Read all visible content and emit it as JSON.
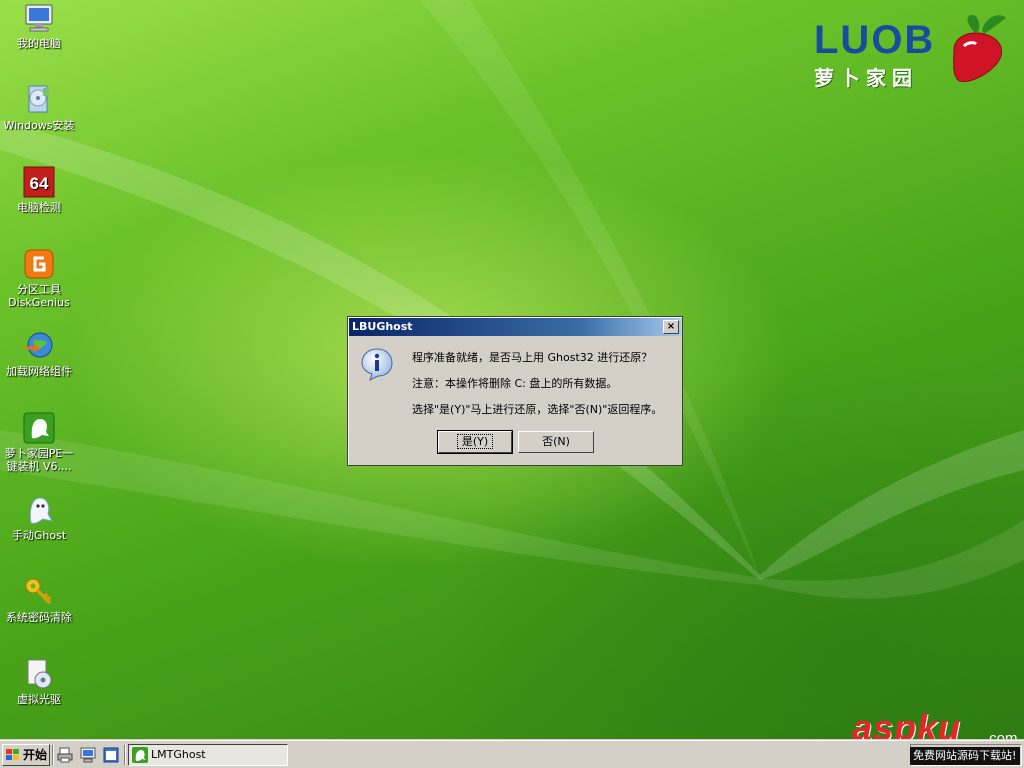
{
  "desktop": {
    "icons": [
      {
        "label": "我的电脑",
        "icon": "computer-icon"
      },
      {
        "label": "Windows安装",
        "icon": "windows-setup-icon"
      },
      {
        "label": "电脑检测",
        "icon": "aida64-icon"
      },
      {
        "label": "分区工具",
        "label2": "DiskGenius",
        "icon": "diskgenius-icon"
      },
      {
        "label": "加载网络组件",
        "icon": "network-globe-icon"
      },
      {
        "label": "萝卜家园PE一",
        "label2": "键装机 V6....",
        "icon": "ghost-green-icon"
      },
      {
        "label": "手动Ghost",
        "icon": "ghost-icon"
      },
      {
        "label": "系统密码清除",
        "icon": "key-icon"
      },
      {
        "label": "虚拟光驱",
        "icon": "virtual-drive-icon"
      }
    ]
  },
  "logo": {
    "text": "LUOB",
    "subtitle": "萝卜家园"
  },
  "dialog": {
    "title": "LBUGhost",
    "close": "×",
    "line1": "程序准备就绪，是否马上用 Ghost32 进行还原？",
    "line2": "注意：本操作将删除 C: 盘上的所有数据。",
    "line3": "选择\"是(Y)\"马上进行还原，选择\"否(N)\"返回程序。",
    "yes": "是(Y)",
    "no": "否(N)"
  },
  "taskbar": {
    "start": "开始",
    "task": "LMTGhost"
  },
  "watermark": {
    "brand": "aspku",
    "com": ".com",
    "sub": "免费网站源码下载站!"
  },
  "colors": {
    "accent_title": "#0a246a",
    "desktop_green": "#5fb822",
    "watermark_red": "#e8242a"
  }
}
